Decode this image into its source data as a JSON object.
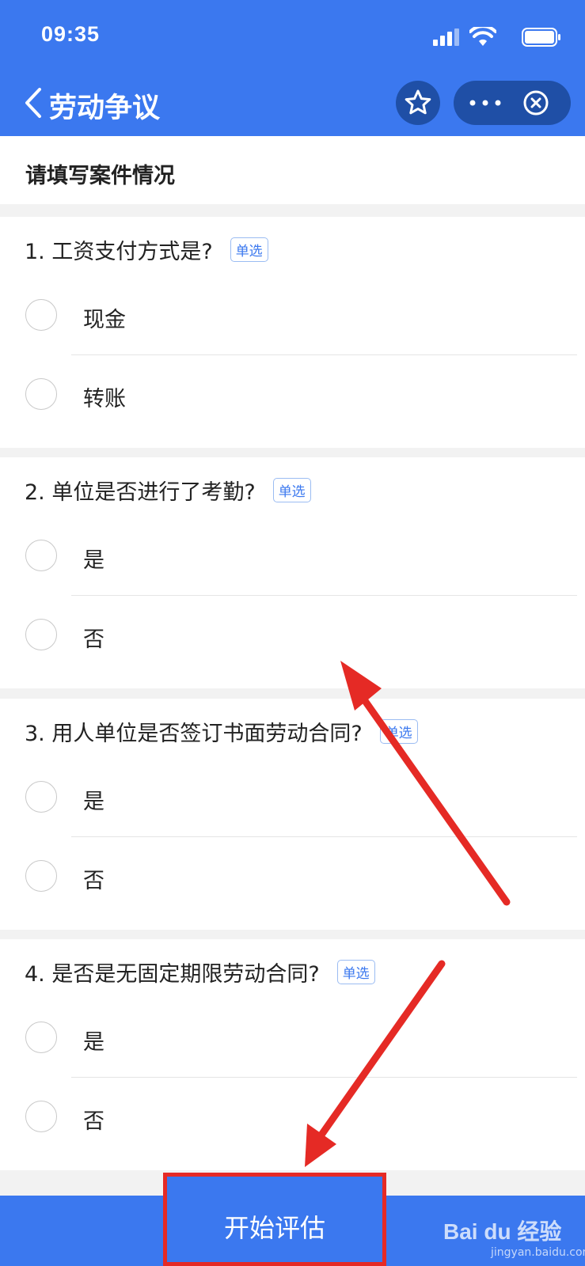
{
  "status": {
    "time": "09:35"
  },
  "nav": {
    "title": "劳动争议"
  },
  "page": {
    "header": "请填写案件情况"
  },
  "questions": [
    {
      "title": "1. 工资支付方式是?",
      "badge": "单选",
      "options": [
        "现金",
        "转账"
      ]
    },
    {
      "title": "2. 单位是否进行了考勤?",
      "badge": "单选",
      "options": [
        "是",
        "否"
      ]
    },
    {
      "title": "3. 用人单位是否签订书面劳动合同?",
      "badge": "单选",
      "options": [
        "是",
        "否"
      ]
    },
    {
      "title": "4. 是否是无固定期限劳动合同?",
      "badge": "单选",
      "options": [
        "是",
        "否"
      ]
    }
  ],
  "footer": {
    "start_label": "开始评估"
  },
  "watermark": {
    "brand": "Bai du 经验",
    "url": "jingyan.baidu.com"
  },
  "colors": {
    "primary": "#3b78ef",
    "capsule": "#1f4fa6",
    "annotation": "#e52a25"
  },
  "icons": [
    "back-icon",
    "star-icon",
    "more-icon",
    "close-icon",
    "signal-icon",
    "wifi-icon",
    "battery-icon"
  ]
}
